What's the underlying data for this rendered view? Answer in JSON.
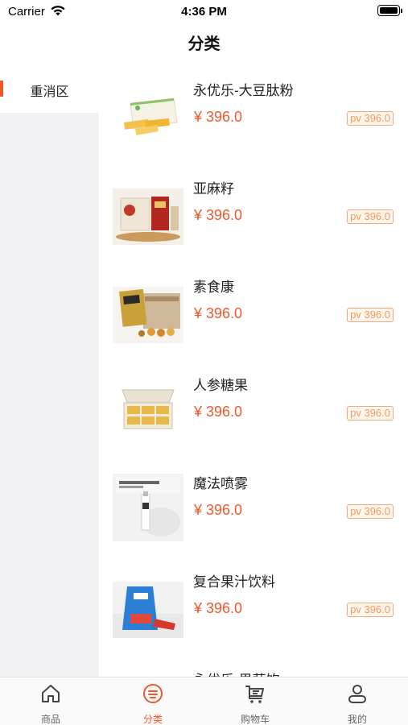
{
  "status_bar": {
    "carrier": "Carrier",
    "time": "4:36 PM"
  },
  "header": {
    "title": "分类"
  },
  "sidebar": {
    "items": [
      {
        "label": "重消区",
        "selected": true
      }
    ]
  },
  "products": [
    {
      "name": "永优乐-大豆肽粉",
      "price": "¥ 396.0",
      "pv": "pv 396.0",
      "image": "soy-peptide-powder-box"
    },
    {
      "name": "亚麻籽",
      "price": "¥ 396.0",
      "pv": "pv 396.0",
      "image": "flaxseed-box"
    },
    {
      "name": "素食康",
      "price": "¥ 396.0",
      "pv": "pv 396.0",
      "image": "vegetarian-food-box"
    },
    {
      "name": "人参糖果",
      "price": "¥ 396.0",
      "pv": "pv 396.0",
      "image": "ginseng-candy-box",
      "image_caption": "苓康尔人参糖果"
    },
    {
      "name": "魔法喷雾",
      "price": "¥ 396.0",
      "pv": "pv 396.0",
      "image": "spray-bottle",
      "image_caption": "风雅润红光眼润"
    },
    {
      "name": "复合果汁饮料",
      "price": "¥ 396.0",
      "pv": "pv 396.0",
      "image": "juice-pouch"
    },
    {
      "name": "永优乐-果蔬饮",
      "price": "",
      "pv": "",
      "image": ""
    }
  ],
  "tabbar": {
    "tabs": [
      {
        "label": "商品",
        "icon": "home-icon",
        "active": false
      },
      {
        "label": "分类",
        "icon": "category-icon",
        "active": true
      },
      {
        "label": "购物车",
        "icon": "cart-icon",
        "active": false
      },
      {
        "label": "我的",
        "icon": "user-icon",
        "active": false
      }
    ]
  },
  "colors": {
    "accent": "#f0572a",
    "pv_border": "#f6a777",
    "sidebar_bg": "#f2f2f5"
  }
}
